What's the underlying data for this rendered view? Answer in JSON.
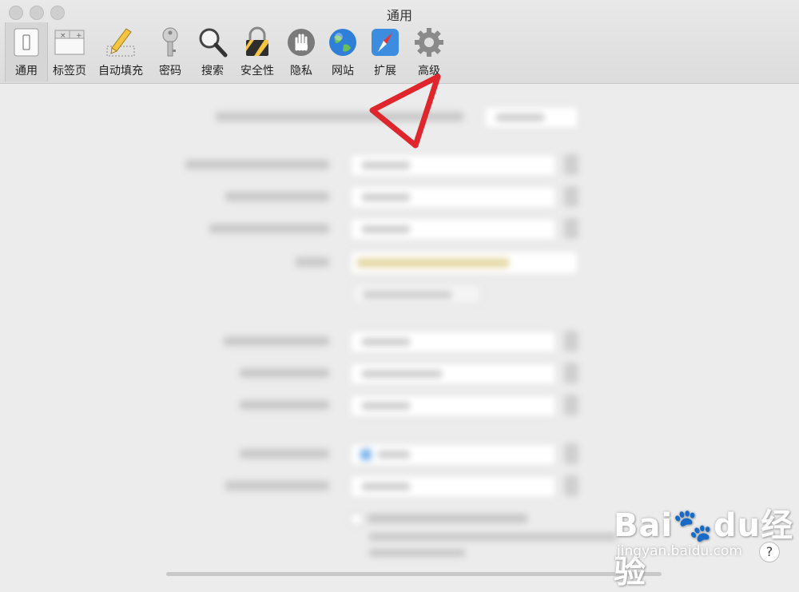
{
  "window": {
    "title": "通用"
  },
  "toolbar": {
    "items": [
      {
        "label": "通用",
        "icon": "switch-icon",
        "selected": true
      },
      {
        "label": "标签页",
        "icon": "tabs-icon",
        "selected": false
      },
      {
        "label": "自动填充",
        "icon": "pencil-icon",
        "selected": false
      },
      {
        "label": "密码",
        "icon": "key-icon",
        "selected": false
      },
      {
        "label": "搜索",
        "icon": "magnifier-icon",
        "selected": false
      },
      {
        "label": "安全性",
        "icon": "lock-icon",
        "selected": false
      },
      {
        "label": "隐私",
        "icon": "hand-icon",
        "selected": false
      },
      {
        "label": "网站",
        "icon": "globe-icon",
        "selected": false
      },
      {
        "label": "扩展",
        "icon": "compass-icon",
        "selected": false
      },
      {
        "label": "高级",
        "icon": "gear-icon",
        "selected": false
      }
    ]
  },
  "colors": {
    "annotation_arrow": "#e0262d",
    "background": "#ececec"
  },
  "watermark": {
    "brand": "Bai",
    "brand_paw": "du",
    "brand_cn": "经验",
    "site": "jingyan.baidu.com"
  },
  "help_button": {
    "label": "?"
  }
}
